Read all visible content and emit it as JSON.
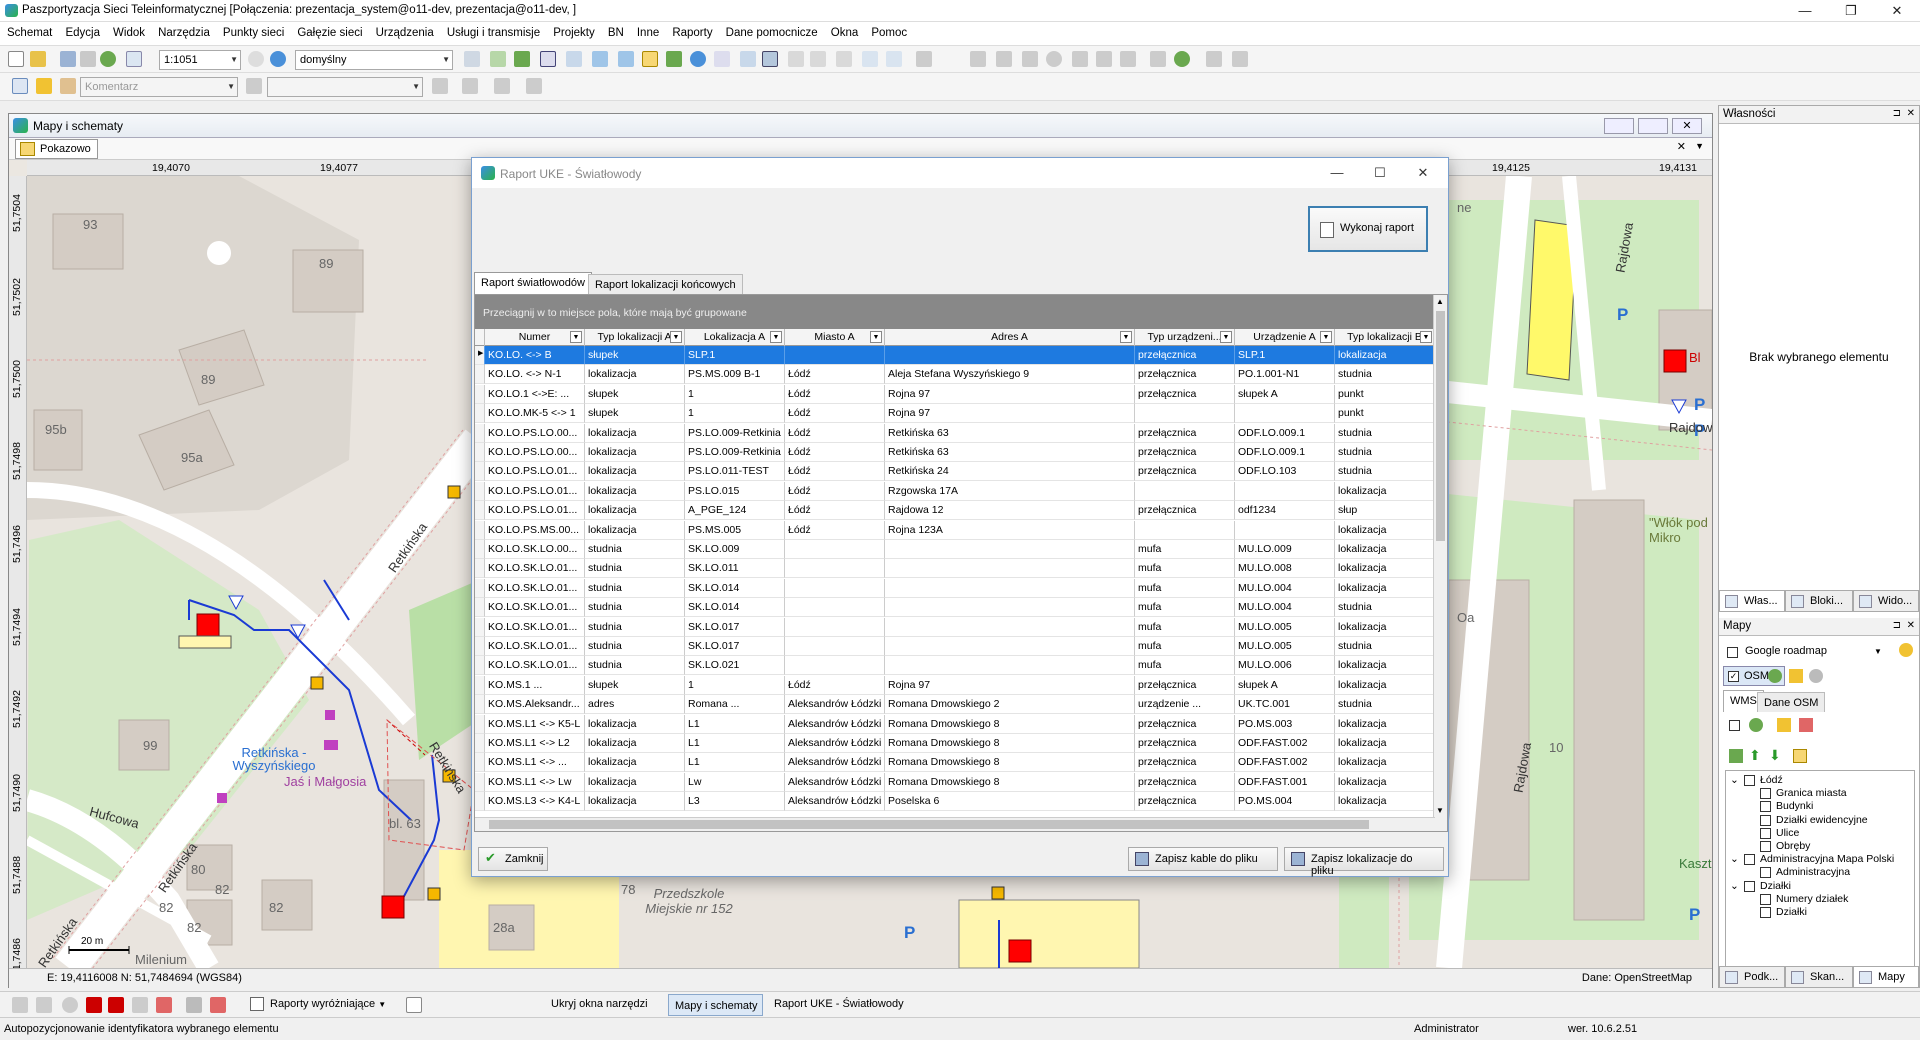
{
  "window": {
    "title": "Paszportyzacja Sieci Teleinformatycznej [Połączenia: prezentacja_system@o11-dev, prezentacja@o11-dev, ]",
    "min_glyph": "—",
    "max_glyph": "❐",
    "close_glyph": "✕"
  },
  "menu": [
    "Schemat",
    "Edycja",
    "Widok",
    "Narzędzia",
    "Punkty sieci",
    "Gałęzie sieci",
    "Urządzenia",
    "Usługi i transmisje",
    "Projekty",
    "BN",
    "Inne",
    "Raporty",
    "Dane pomocnicze",
    "Okna",
    "Pomoc"
  ],
  "toolbar": {
    "scale_value": "1:1051",
    "style_value": "domyślny",
    "comment_placeholder": "Komentarz"
  },
  "map_window": {
    "title": "Mapy i schematy",
    "tab_label": "Pokazowo",
    "x_ticks": [
      "19,4070",
      "19,4077",
      "19,4125",
      "19,4131"
    ],
    "y_ticks": [
      "51,7504",
      "51,7502",
      "51,7500",
      "51,7498",
      "51,7496",
      "51,7494",
      "51,7492",
      "51,7490",
      "51,7488",
      "51,7486"
    ],
    "coords": "E: 19,4116008  N: 51,7484694 (WGS84)",
    "source": "Dane: OpenStreetMap",
    "scale_bar": "20 m",
    "labels": {
      "house93": "93",
      "house89a": "89",
      "house89b": "89",
      "house95b": "95b",
      "house95a": "95a",
      "house99": "99",
      "bl63": "bl. 63",
      "h80": "80",
      "h82a": "82",
      "h82b": "82",
      "h82c": "82",
      "h82d": "82",
      "h78": "78",
      "h28a": "28a",
      "retkinska1": "Retkińska",
      "retkinska2": "Retkińska",
      "retkinska3": "Retkińska",
      "retkinska4": "Retkińska",
      "hufcowa": "Hufcowa",
      "busstop": "Retkińska - Wyszyńskiego",
      "jasi": "Jaś i Małgosia",
      "przedszkole": "Przedszkole Miejskie nr 152",
      "milenium": "Milenium",
      "rajdowa1": "Rajdowa",
      "rajdowa2": "Rajdowa",
      "rajdowa3": "Rajdowa",
      "wlok": "\"Włók pod Mikro",
      "kaszta": "Kaszta",
      "h10": "10",
      "oa": "Oa",
      "ne": "ne",
      "bl": "Bl"
    }
  },
  "dialog": {
    "title": "Raport UKE - Światłowody",
    "execute_button": "Wykonaj raport",
    "tabs": [
      "Raport światłowodów",
      "Raport lokalizacji końcowych"
    ],
    "group_hint": "Przeciągnij w to miejsce pola, które mają być grupowane",
    "columns": [
      "Numer",
      "Typ lokalizacji A",
      "Lokalizacja A",
      "Miasto A",
      "Adres A",
      "Typ urządzeni...",
      "Urządzenie A",
      "Typ lokalizacji B"
    ],
    "rows": [
      [
        "KO.LO. <-> B",
        "słupek",
        "SLP.1",
        "",
        "",
        "przełącznica",
        "SLP.1",
        "lokalizacja"
      ],
      [
        "KO.LO. <-> N-1",
        "lokalizacja",
        "PS.MS.009 B-1",
        "Łódź",
        "Aleja Stefana Wyszyńskiego 9",
        "przełącznica",
        "PO.1.001-N1",
        "studnia"
      ],
      [
        "KO.LO.1 <->E: ...",
        "słupek",
        "1",
        "Łódź",
        "Rojna 97",
        "przełącznica",
        "słupek A",
        "punkt"
      ],
      [
        "KO.LO.MK-5 <-> 1",
        "słupek",
        "1",
        "Łódź",
        "Rojna 97",
        "",
        "",
        "punkt"
      ],
      [
        "KO.LO.PS.LO.00...",
        "lokalizacja",
        "PS.LO.009-Retkinia",
        "Łódź",
        "Retkińska 63",
        "przełącznica",
        "ODF.LO.009.1",
        "studnia"
      ],
      [
        "KO.LO.PS.LO.00...",
        "lokalizacja",
        "PS.LO.009-Retkinia",
        "Łódź",
        "Retkińska 63",
        "przełącznica",
        "ODF.LO.009.1",
        "studnia"
      ],
      [
        "KO.LO.PS.LO.01...",
        "lokalizacja",
        "PS.LO.011-TEST",
        "Łódź",
        "Retkińska 24",
        "przełącznica",
        "ODF.LO.103",
        "studnia"
      ],
      [
        "KO.LO.PS.LO.01...",
        "lokalizacja",
        "PS.LO.015",
        "Łódź",
        "Rzgowska 17A",
        "",
        "",
        "lokalizacja"
      ],
      [
        "KO.LO.PS.LO.01...",
        "lokalizacja",
        "A_PGE_124",
        "Łódź",
        "Rajdowa 12",
        "przełącznica",
        "odf1234",
        "słup"
      ],
      [
        "KO.LO.PS.MS.00...",
        "lokalizacja",
        "PS.MS.005",
        "Łódź",
        "Rojna 123A",
        "",
        "",
        "lokalizacja"
      ],
      [
        "KO.LO.SK.LO.00...",
        "studnia",
        "SK.LO.009",
        "",
        "",
        "mufa",
        "MU.LO.009",
        "lokalizacja"
      ],
      [
        "KO.LO.SK.LO.01...",
        "studnia",
        "SK.LO.011",
        "",
        "",
        "mufa",
        "MU.LO.008",
        "lokalizacja"
      ],
      [
        "KO.LO.SK.LO.01...",
        "studnia",
        "SK.LO.014",
        "",
        "",
        "mufa",
        "MU.LO.004",
        "lokalizacja"
      ],
      [
        "KO.LO.SK.LO.01...",
        "studnia",
        "SK.LO.014",
        "",
        "",
        "mufa",
        "MU.LO.004",
        "studnia"
      ],
      [
        "KO.LO.SK.LO.01...",
        "studnia",
        "SK.LO.017",
        "",
        "",
        "mufa",
        "MU.LO.005",
        "lokalizacja"
      ],
      [
        "KO.LO.SK.LO.01...",
        "studnia",
        "SK.LO.017",
        "",
        "",
        "mufa",
        "MU.LO.005",
        "studnia"
      ],
      [
        "KO.LO.SK.LO.01...",
        "studnia",
        "SK.LO.021",
        "",
        "",
        "mufa",
        "MU.LO.006",
        "lokalizacja"
      ],
      [
        "KO.MS.1 ...",
        "słupek",
        "1",
        "Łódź",
        "Rojna 97",
        "przełącznica",
        "słupek A",
        "lokalizacja"
      ],
      [
        "KO.MS.Aleksandr...",
        "adres",
        "Romana ...",
        "Aleksandrów Łódzki",
        "Romana Dmowskiego 2",
        "urządzenie ...",
        "UK.TC.001",
        "studnia"
      ],
      [
        "KO.MS.L1 <-> K5-L",
        "lokalizacja",
        "L1",
        "Aleksandrów Łódzki",
        "Romana Dmowskiego 8",
        "przełącznica",
        "PO.MS.003",
        "lokalizacja"
      ],
      [
        "KO.MS.L1 <-> L2",
        "lokalizacja",
        "L1",
        "Aleksandrów Łódzki",
        "Romana Dmowskiego 8",
        "przełącznica",
        "ODF.FAST.002",
        "lokalizacja"
      ],
      [
        "KO.MS.L1 <-> ...",
        "lokalizacja",
        "L1",
        "Aleksandrów Łódzki",
        "Romana Dmowskiego 8",
        "przełącznica",
        "ODF.FAST.002",
        "lokalizacja"
      ],
      [
        "KO.MS.L1 <-> Lw",
        "lokalizacja",
        "Lw",
        "Aleksandrów Łódzki",
        "Romana Dmowskiego 8",
        "przełącznica",
        "ODF.FAST.001",
        "lokalizacja"
      ],
      [
        "KO.MS.L3 <-> K4-L",
        "lokalizacja",
        "L3",
        "Aleksandrów Łódzki",
        "Poselska 6",
        "przełącznica",
        "PO.MS.004",
        "lokalizacja"
      ]
    ],
    "close_button": "Zamknij",
    "save_cables_button": "Zapisz kable do pliku",
    "save_locations_button": "Zapisz lokalizacje do pliku"
  },
  "properties_panel": {
    "title": "Własności",
    "empty_text": "Brak wybranego elementu",
    "tabs": [
      "Włas...",
      "Bloki...",
      "Wido..."
    ]
  },
  "maps_panel": {
    "title": "Mapy",
    "google_label": "Google roadmap",
    "osm_label": "OSM",
    "subtabs": [
      "WMS",
      "Dane OSM"
    ],
    "tree": [
      {
        "label": "Łódź",
        "level": 0,
        "expander": true
      },
      {
        "label": "Granica miasta",
        "level": 1
      },
      {
        "label": "Budynki",
        "level": 1
      },
      {
        "label": "Działki ewidencyjne",
        "level": 1
      },
      {
        "label": "Ulice",
        "level": 1
      },
      {
        "label": "Obręby",
        "level": 1
      },
      {
        "label": "Administracyjna Mapa Polski",
        "level": 0,
        "expander": true
      },
      {
        "label": "Administracyjna",
        "level": 1
      },
      {
        "label": "Działki",
        "level": 0,
        "expander": true
      },
      {
        "label": "Numery działek",
        "level": 1
      },
      {
        "label": "Działki",
        "level": 1
      }
    ],
    "bottom_tabs": [
      "Podk...",
      "Skan...",
      "Mapy"
    ]
  },
  "taskbar": {
    "reports_label": "Raporty wyróżniające",
    "hide_tools": "Ukryj okna narzędzi",
    "task_maps": "Mapy i schematy",
    "task_report": "Raport UKE - Światłowody"
  },
  "status": {
    "hint": "Autopozycjonowanie identyfikatora wybranego elementu",
    "user": "Administrator",
    "version": "wer. 10.6.2.51"
  }
}
